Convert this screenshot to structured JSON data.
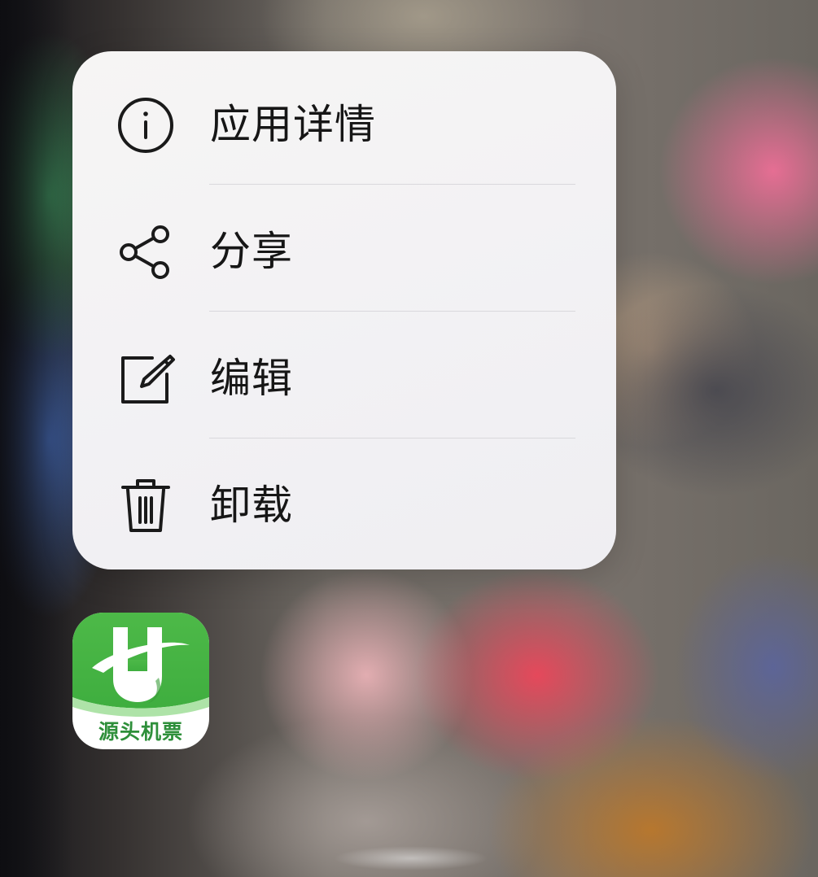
{
  "context_menu": {
    "items": [
      {
        "label": "应用详情",
        "icon": "info-circle-icon"
      },
      {
        "label": "分享",
        "icon": "share-icon"
      },
      {
        "label": "编辑",
        "icon": "edit-icon"
      },
      {
        "label": "卸载",
        "icon": "trash-icon"
      }
    ]
  },
  "app": {
    "name": "源头机票",
    "icon": "app-logo-icon",
    "brand_color": "#4cb84a"
  }
}
